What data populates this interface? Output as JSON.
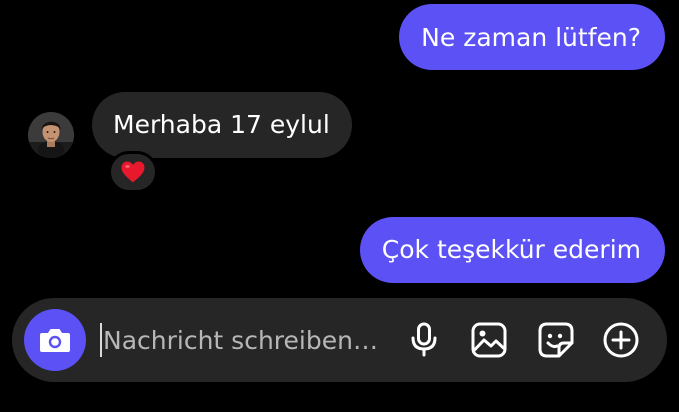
{
  "messages": [
    {
      "direction": "outgoing",
      "text": "Ne zaman lütfen?"
    },
    {
      "direction": "incoming",
      "text": "Merhaba 17 eylul",
      "reaction": "heart-emoji"
    },
    {
      "direction": "outgoing",
      "text": "Çok teşekkür ederim"
    }
  ],
  "composer": {
    "placeholder": "Nachricht schreiben…",
    "value": "",
    "icons": [
      "camera-icon",
      "microphone-icon",
      "gallery-icon",
      "sticker-icon",
      "plus-circle-icon"
    ]
  },
  "colors": {
    "background": "#000000",
    "outgoing_bubble": "#5b51f5",
    "incoming_bubble": "#262626",
    "composer": "#262626",
    "accent": "#5b51f5",
    "reaction_heart": "#e8192c"
  }
}
